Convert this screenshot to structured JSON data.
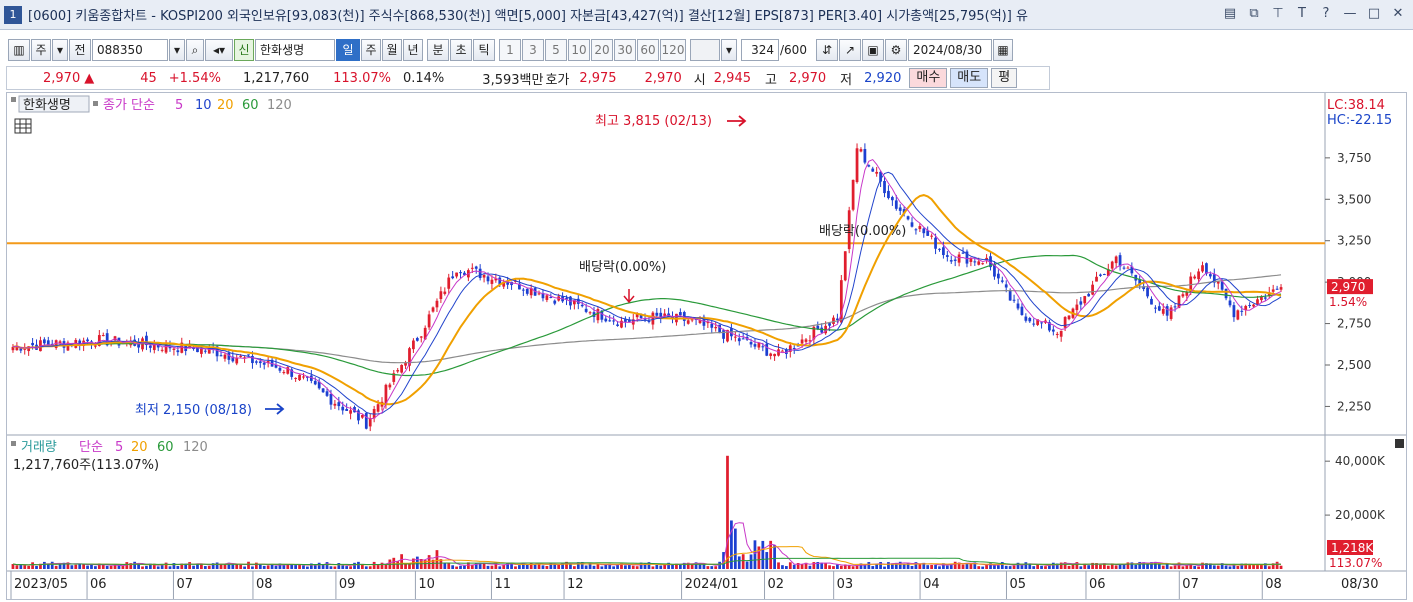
{
  "window": {
    "badge": "1",
    "title": "[0600] 키움종합차트 - KOSPI200 외국인보유[93,083(천)] 주식수[868,530(천)] 액면[5,000] 자본금[43,427(억)] 결산[12월] EPS[873] PER[3.40] 시가총액[25,795(억)] 유",
    "icons": [
      "layout-icon",
      "restore-icon",
      "pin-icon",
      "font-icon",
      "help-icon",
      "minimize-icon",
      "maximize-icon",
      "close-icon"
    ]
  },
  "toolbar": {
    "period_type": "주",
    "jeon_label": "전",
    "code": "088350",
    "shin_label": "신",
    "stock_name": "한화생명",
    "periods": [
      "일",
      "주",
      "월",
      "년",
      "분",
      "초",
      "틱"
    ],
    "active_period": "일",
    "intervals": [
      "1",
      "3",
      "5",
      "10",
      "20",
      "30",
      "60",
      "120"
    ],
    "count": "324",
    "count_max": "/600",
    "date": "2024/08/30"
  },
  "quote": {
    "price": "2,970",
    "arrow": "▲",
    "change": "45",
    "change_pct": "+1.54%",
    "volume": "1,217,760",
    "volume_ratio": "113.07%",
    "turnover": "0.14%",
    "amount": "3,593백만",
    "hoga_label": "호가",
    "ask": "2,975",
    "bid": "2,970",
    "open_label": "시",
    "open": "2,945",
    "high_label": "고",
    "high": "2,970",
    "low_label": "저",
    "low": "2,920",
    "buy_label": "매수",
    "sell_label": "매도",
    "eval_label": "평"
  },
  "price_panel": {
    "stock_tag": "한화생명",
    "ma_title": "종가 단순",
    "ma_periods": [
      "5",
      "10",
      "20",
      "60",
      "120"
    ],
    "lc": "LC:38.14",
    "hc": "HC:-22.15",
    "y_ticks": [
      "3,750",
      "3,500",
      "3,250",
      "3,000",
      "2,750",
      "2,500",
      "2,250"
    ],
    "last_price_tag": "2,970",
    "last_pct_tag": "1.54%",
    "high_note": "최고 3,815 (02/13)",
    "low_note": "최저 2,150 (08/18)",
    "dividend_notes": [
      "배당락(0.00%)",
      "배당락(0.00%)"
    ]
  },
  "volume_panel": {
    "title": "거래량",
    "ma_title": "단순",
    "ma_periods": [
      "5",
      "20",
      "60",
      "120"
    ],
    "current": "1,217,760주(113.07%)",
    "y_ticks": [
      "40,000K",
      "20,000K"
    ],
    "last_tag": "1,218K",
    "last_pct": "113.07%"
  },
  "x_axis": {
    "labels": [
      "2023/05",
      "06",
      "07",
      "08",
      "09",
      "10",
      "11",
      "12",
      "2024/01",
      "02",
      "03",
      "04",
      "05",
      "06",
      "07",
      "08"
    ],
    "last_date": "08/30"
  },
  "colors": {
    "up": "#e01e2e",
    "down": "#1c3fd1",
    "ma5": "#c838c8",
    "ma10": "#2244cc",
    "ma20": "#f0a000",
    "ma60": "#2a9a3a",
    "ma120": "#8c8c8c",
    "hline": "#f39a1a"
  },
  "chart_data": {
    "type": "candlestick",
    "title": "한화생명",
    "ylim": [
      2150,
      3900
    ],
    "horizontal_line": 3235,
    "points": [
      {
        "date": "2023/05",
        "close": 2610
      },
      {
        "date": "06",
        "close": 2650
      },
      {
        "date": "07",
        "close": 2590
      },
      {
        "date": "08",
        "close": 2470
      },
      {
        "date": "08/18",
        "close": 2150
      },
      {
        "date": "09",
        "close": 2620
      },
      {
        "date": "09/15",
        "close": 3090
      },
      {
        "date": "10",
        "close": 2990
      },
      {
        "date": "11",
        "close": 2760
      },
      {
        "date": "12",
        "close": 2790
      },
      {
        "date": "12/27",
        "close": 2770
      },
      {
        "date": "2024/01",
        "close": 2560
      },
      {
        "date": "01/25",
        "close": 2790
      },
      {
        "date": "02/13",
        "close": 3815
      },
      {
        "date": "02/28",
        "close": 3460
      },
      {
        "date": "03",
        "close": 3160
      },
      {
        "date": "03/28",
        "close": 3130
      },
      {
        "date": "04",
        "close": 2820
      },
      {
        "date": "04/20",
        "close": 2700
      },
      {
        "date": "05",
        "close": 3150
      },
      {
        "date": "06",
        "close": 2780
      },
      {
        "date": "07",
        "close": 3120
      },
      {
        "date": "08",
        "close": 2820
      },
      {
        "date": "08/30",
        "close": 2970
      }
    ],
    "ma20_approx": [
      2650,
      2650,
      2560,
      2520,
      2700,
      3050,
      2920,
      2760,
      2790,
      2710,
      2760,
      3400,
      3250,
      3050,
      2760,
      2980,
      2850,
      2930,
      3020,
      2990
    ],
    "volume": {
      "spike_date": "02",
      "spike_value_k": 42000,
      "typical_k": 2000,
      "last_k": 1218
    }
  }
}
